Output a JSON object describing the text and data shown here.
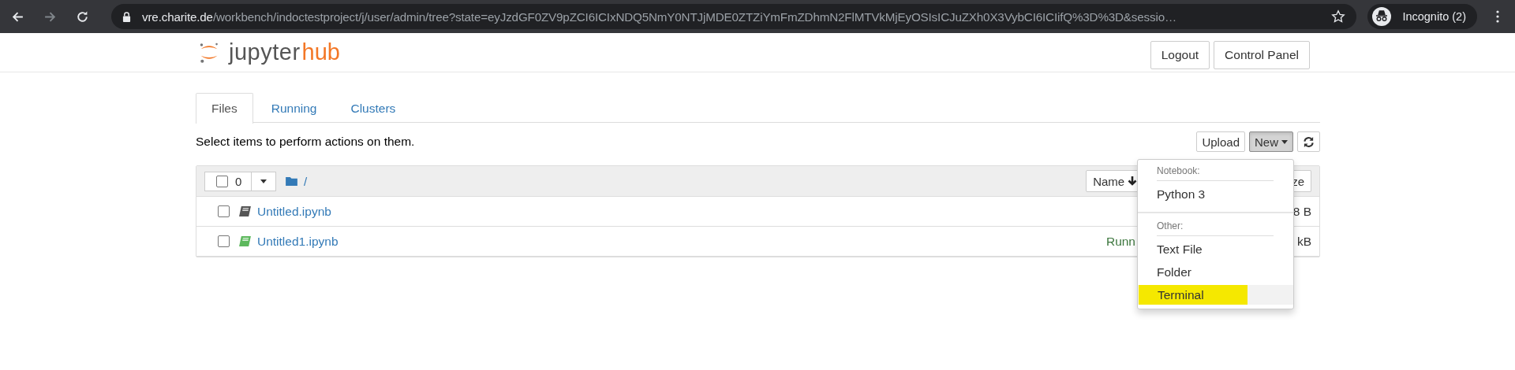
{
  "browser": {
    "url_host": "vre.charite.de",
    "url_path": "/workbench/indoctestproject/j/user/admin/tree?state=eyJzdGF0ZV9pZCI6ICIxNDQ5NmY0NTJjMDE0ZTZiYmFmZDhmN2FlMTVkMjEyOSIsICJuZXh0X3VybCI6ICIifQ%3D%3D&sessio…",
    "profile": "Incognito (2)"
  },
  "header": {
    "logo_main": "jupyter",
    "logo_accent": "hub",
    "buttons": [
      "Logout",
      "Control Panel"
    ]
  },
  "tabs": [
    {
      "label": "Files",
      "selected": true
    },
    {
      "label": "Running",
      "selected": false
    },
    {
      "label": "Clusters",
      "selected": false
    }
  ],
  "hint": "Select items to perform actions on them.",
  "toolbar": {
    "upload": "Upload",
    "new": "New",
    "new_open": true
  },
  "list_header": {
    "count": "0",
    "path": "/",
    "sort": "Name",
    "column_3": "ze"
  },
  "files": [
    {
      "checked": false,
      "name": "Untitled.ipynb",
      "running": false,
      "size": "8 B"
    },
    {
      "checked": false,
      "name": "Untitled1.ipynb",
      "running": true,
      "status": "Runn",
      "size": "kB"
    }
  ],
  "menu": [
    {
      "kind": "header",
      "label": "Notebook:"
    },
    {
      "kind": "item",
      "label": "Python 3",
      "selected": false,
      "highlighted": false
    },
    {
      "kind": "divider"
    },
    {
      "kind": "header",
      "label": "Other:"
    },
    {
      "kind": "item",
      "label": "Text File",
      "selected": false,
      "highlighted": false
    },
    {
      "kind": "item",
      "label": "Folder",
      "selected": false,
      "highlighted": false
    },
    {
      "kind": "item",
      "label": "Terminal",
      "selected": true,
      "highlighted": true
    }
  ]
}
